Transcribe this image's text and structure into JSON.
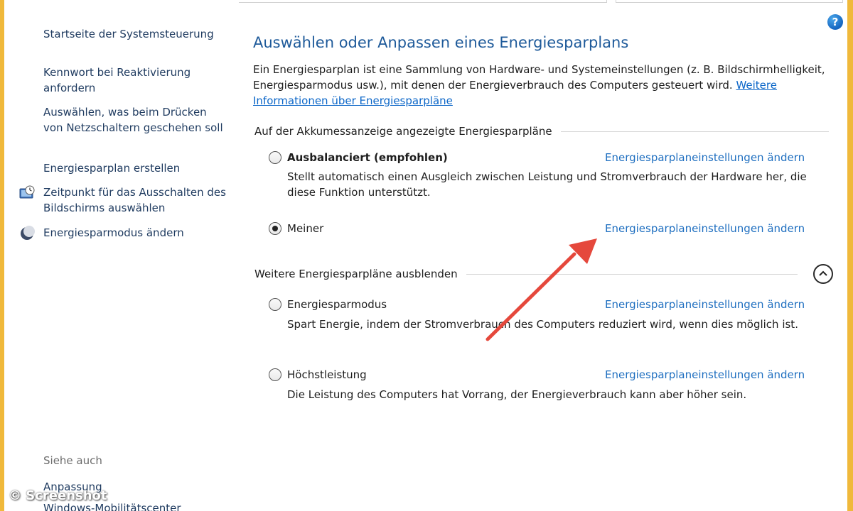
{
  "sidebar": {
    "items": [
      {
        "label": "Startseite der Systemsteuerung"
      },
      {
        "label": "Kennwort bei Reaktivierung anfordern"
      },
      {
        "label": "Auswählen, was beim Drücken von Netzschaltern geschehen soll"
      },
      {
        "label": "Energiesparplan erstellen"
      },
      {
        "label": "Zeitpunkt für das Ausschalten des Bildschirms auswählen",
        "icon": "display-clock-icon"
      },
      {
        "label": "Energiesparmodus ändern",
        "icon": "moon-icon"
      }
    ],
    "see_also": "Siehe auch",
    "see_also_items": [
      {
        "label": "Anpassung"
      },
      {
        "label": "Windows-Mobilitätscenter"
      }
    ]
  },
  "main": {
    "title": "Auswählen oder Anpassen eines Energiesparplans",
    "intro_text": "Ein Energiesparplan ist eine Sammlung von Hardware- und Systemeinstellungen (z. B. Bildschirmhelligkeit, Energiesparmodus usw.), mit denen der Energieverbrauch des Computers gesteuert wird.",
    "intro_link": "Weitere Informationen über Energiesparpläne",
    "group1_header": "Auf der Akkumessanzeige angezeigte Energiesparpläne",
    "group2_header": "Weitere Energiesparpläne ausblenden",
    "change_link": "Energiesparplaneinstellungen ändern",
    "plans": [
      {
        "name": "Ausbalanciert (empfohlen)",
        "desc": "Stellt automatisch einen Ausgleich zwischen Leistung und Stromverbrauch der Hardware her, die diese Funktion unterstützt.",
        "selected": false
      },
      {
        "name": "Meiner",
        "desc": "",
        "selected": true
      },
      {
        "name": "Energiesparmodus",
        "desc": "Spart Energie, indem der Stromverbrauch des Computers reduziert wird, wenn dies möglich ist.",
        "selected": false
      },
      {
        "name": "Höchstleistung",
        "desc": "Die Leistung des Computers hat Vorrang, der Energieverbrauch kann aber höher sein.",
        "selected": false
      }
    ]
  },
  "help_icon": "help-icon",
  "watermark": "© Screenshot",
  "colors": {
    "accent": "#1f6fc0",
    "title": "#1e5a9a",
    "frame": "#f0b93b",
    "annotation_arrow": "#e5483c"
  }
}
